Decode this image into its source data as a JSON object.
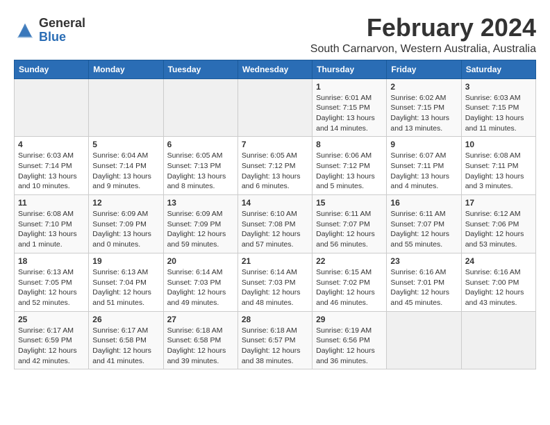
{
  "header": {
    "logo_general": "General",
    "logo_blue": "Blue",
    "month_year": "February 2024",
    "location": "South Carnarvon, Western Australia, Australia"
  },
  "calendar": {
    "days_of_week": [
      "Sunday",
      "Monday",
      "Tuesday",
      "Wednesday",
      "Thursday",
      "Friday",
      "Saturday"
    ],
    "weeks": [
      [
        {
          "day": "",
          "info": ""
        },
        {
          "day": "",
          "info": ""
        },
        {
          "day": "",
          "info": ""
        },
        {
          "day": "",
          "info": ""
        },
        {
          "day": "1",
          "info": "Sunrise: 6:01 AM\nSunset: 7:15 PM\nDaylight: 13 hours\nand 14 minutes."
        },
        {
          "day": "2",
          "info": "Sunrise: 6:02 AM\nSunset: 7:15 PM\nDaylight: 13 hours\nand 13 minutes."
        },
        {
          "day": "3",
          "info": "Sunrise: 6:03 AM\nSunset: 7:15 PM\nDaylight: 13 hours\nand 11 minutes."
        }
      ],
      [
        {
          "day": "4",
          "info": "Sunrise: 6:03 AM\nSunset: 7:14 PM\nDaylight: 13 hours\nand 10 minutes."
        },
        {
          "day": "5",
          "info": "Sunrise: 6:04 AM\nSunset: 7:14 PM\nDaylight: 13 hours\nand 9 minutes."
        },
        {
          "day": "6",
          "info": "Sunrise: 6:05 AM\nSunset: 7:13 PM\nDaylight: 13 hours\nand 8 minutes."
        },
        {
          "day": "7",
          "info": "Sunrise: 6:05 AM\nSunset: 7:12 PM\nDaylight: 13 hours\nand 6 minutes."
        },
        {
          "day": "8",
          "info": "Sunrise: 6:06 AM\nSunset: 7:12 PM\nDaylight: 13 hours\nand 5 minutes."
        },
        {
          "day": "9",
          "info": "Sunrise: 6:07 AM\nSunset: 7:11 PM\nDaylight: 13 hours\nand 4 minutes."
        },
        {
          "day": "10",
          "info": "Sunrise: 6:08 AM\nSunset: 7:11 PM\nDaylight: 13 hours\nand 3 minutes."
        }
      ],
      [
        {
          "day": "11",
          "info": "Sunrise: 6:08 AM\nSunset: 7:10 PM\nDaylight: 13 hours\nand 1 minute."
        },
        {
          "day": "12",
          "info": "Sunrise: 6:09 AM\nSunset: 7:09 PM\nDaylight: 13 hours\nand 0 minutes."
        },
        {
          "day": "13",
          "info": "Sunrise: 6:09 AM\nSunset: 7:09 PM\nDaylight: 12 hours\nand 59 minutes."
        },
        {
          "day": "14",
          "info": "Sunrise: 6:10 AM\nSunset: 7:08 PM\nDaylight: 12 hours\nand 57 minutes."
        },
        {
          "day": "15",
          "info": "Sunrise: 6:11 AM\nSunset: 7:07 PM\nDaylight: 12 hours\nand 56 minutes."
        },
        {
          "day": "16",
          "info": "Sunrise: 6:11 AM\nSunset: 7:07 PM\nDaylight: 12 hours\nand 55 minutes."
        },
        {
          "day": "17",
          "info": "Sunrise: 6:12 AM\nSunset: 7:06 PM\nDaylight: 12 hours\nand 53 minutes."
        }
      ],
      [
        {
          "day": "18",
          "info": "Sunrise: 6:13 AM\nSunset: 7:05 PM\nDaylight: 12 hours\nand 52 minutes."
        },
        {
          "day": "19",
          "info": "Sunrise: 6:13 AM\nSunset: 7:04 PM\nDaylight: 12 hours\nand 51 minutes."
        },
        {
          "day": "20",
          "info": "Sunrise: 6:14 AM\nSunset: 7:03 PM\nDaylight: 12 hours\nand 49 minutes."
        },
        {
          "day": "21",
          "info": "Sunrise: 6:14 AM\nSunset: 7:03 PM\nDaylight: 12 hours\nand 48 minutes."
        },
        {
          "day": "22",
          "info": "Sunrise: 6:15 AM\nSunset: 7:02 PM\nDaylight: 12 hours\nand 46 minutes."
        },
        {
          "day": "23",
          "info": "Sunrise: 6:16 AM\nSunset: 7:01 PM\nDaylight: 12 hours\nand 45 minutes."
        },
        {
          "day": "24",
          "info": "Sunrise: 6:16 AM\nSunset: 7:00 PM\nDaylight: 12 hours\nand 43 minutes."
        }
      ],
      [
        {
          "day": "25",
          "info": "Sunrise: 6:17 AM\nSunset: 6:59 PM\nDaylight: 12 hours\nand 42 minutes."
        },
        {
          "day": "26",
          "info": "Sunrise: 6:17 AM\nSunset: 6:58 PM\nDaylight: 12 hours\nand 41 minutes."
        },
        {
          "day": "27",
          "info": "Sunrise: 6:18 AM\nSunset: 6:58 PM\nDaylight: 12 hours\nand 39 minutes."
        },
        {
          "day": "28",
          "info": "Sunrise: 6:18 AM\nSunset: 6:57 PM\nDaylight: 12 hours\nand 38 minutes."
        },
        {
          "day": "29",
          "info": "Sunrise: 6:19 AM\nSunset: 6:56 PM\nDaylight: 12 hours\nand 36 minutes."
        },
        {
          "day": "",
          "info": ""
        },
        {
          "day": "",
          "info": ""
        }
      ]
    ]
  }
}
